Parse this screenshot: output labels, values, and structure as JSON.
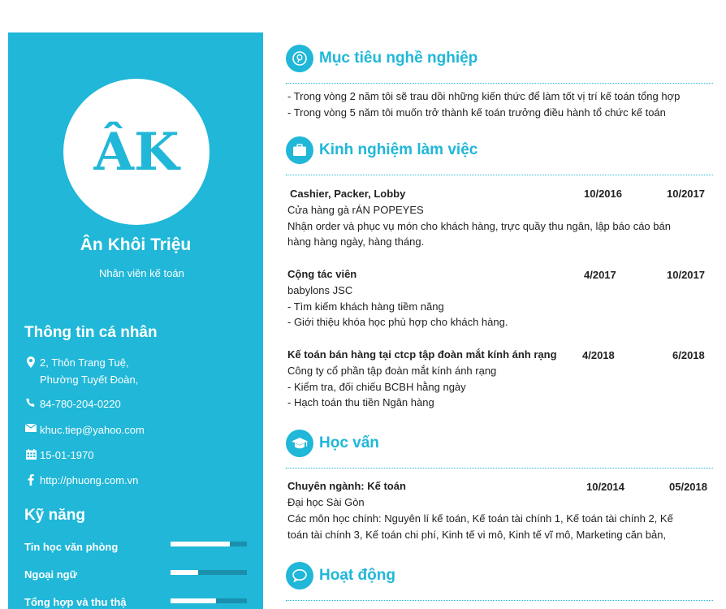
{
  "profile": {
    "initials": "ÂK",
    "name": "Ân Khôi Triệu",
    "title": "Nhân viên kế toán"
  },
  "personal": {
    "heading": "Thông tin cá nhân",
    "address_line1": "2, Thôn Trang Tuệ,",
    "address_line2": "Phường Tuyết Đoàn,",
    "phone": "84-780-204-0220",
    "email": "khuc.tiep@yahoo.com",
    "birthday": "15-01-1970",
    "website": "http://phuong.com.vn"
  },
  "skills": {
    "heading": "Kỹ năng",
    "items": [
      {
        "label": "Tin học văn phòng",
        "level": 0.78
      },
      {
        "label": "Ngoại ngữ",
        "level": 0.36
      },
      {
        "label": "Tổng hợp và thu thậ",
        "level": 0.6
      }
    ]
  },
  "objective": {
    "heading": "Mục tiêu nghề nghiệp",
    "line1": "- Trong vòng 2 năm tôi sẽ trau dồi những kiến thức để làm tốt vị trí kế toán tổng hợp",
    "line2": "- Trong vòng 5 năm tôi muốn trở thành kế toán trưởng điều hành tổ chức kế toán"
  },
  "experience": {
    "heading": "Kinh nghiệm làm việc",
    "jobs": [
      {
        "position": "Cashier, Packer, Lobby",
        "start": "10/2016",
        "end": "10/2017",
        "company": "Cửa hàng gà rÁN POPEYES",
        "desc1": "Nhận order và phục vụ món cho khách hàng, trực quầy thu ngân, lập báo cáo  bán",
        "desc2": "hàng hàng ngày, hàng tháng."
      },
      {
        "position": "Cộng tác viên",
        "start": "4/2017",
        "end": "10/2017",
        "company": "babylons JSC",
        "desc1": "- Tìm kiếm khách hàng tiềm năng",
        "desc2": "- Giới thiệu khóa học phù hợp cho khách hàng."
      },
      {
        "position": "Kế toán bán hàng tại ctcp tập đoàn mắt kính ánh rạng",
        "start": "4/2018",
        "end": "6/2018",
        "company": "Công ty cổ phần tập đoàn mắt kính ánh rạng",
        "desc1": "- Kiểm tra, đối chiếu BCBH hằng ngày",
        "desc2": "- Hạch toán thu tiền Ngân hàng"
      }
    ]
  },
  "education": {
    "heading": "Học vấn",
    "major": "Chuyên ngành: Kế toán",
    "start": "10/2014",
    "end": "05/2018",
    "school": "Đại học Sài Gòn",
    "desc1": "Các môn học chính: Nguyên lí kế toán, Kế toán tài chính 1, Kế toán tài chính 2, Kế",
    "desc2": "toán tài chính 3, Kế toán chi phí, Kinh tế vi mô, Kinh tế vĩ mô, Marketing căn bản,"
  },
  "activities": {
    "heading": "Hoạt động"
  },
  "colors": {
    "accent": "#20b7d8",
    "bar_track": "#1a8fae"
  },
  "icons": [
    "map-marker-icon",
    "phone-icon",
    "envelope-icon",
    "calendar-icon",
    "facebook-icon",
    "pinterest-icon",
    "briefcase-icon",
    "graduation-cap-icon",
    "chat-bubble-icon"
  ]
}
